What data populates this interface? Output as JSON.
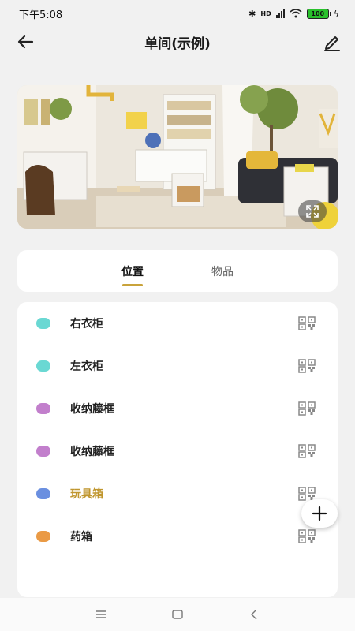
{
  "status_bar": {
    "time": "下午5:08",
    "network": "HD",
    "battery": "100"
  },
  "header": {
    "title": "单间(示例)"
  },
  "tabs": [
    {
      "label": "位置",
      "active": true
    },
    {
      "label": "物品",
      "active": false
    }
  ],
  "locations": [
    {
      "label": "右衣柜",
      "color": "#6ad8d3"
    },
    {
      "label": "左衣柜",
      "color": "#6ad8d3"
    },
    {
      "label": "收纳藤框",
      "color": "#c27fcc"
    },
    {
      "label": "收纳藤框",
      "color": "#c27fcc"
    },
    {
      "label": "玩具箱",
      "color": "#6a8fe0"
    },
    {
      "label": "药箱",
      "color": "#ea9a45"
    }
  ],
  "colors": {
    "accent": "#c9a33b",
    "highlight_text": "#c0962e"
  },
  "icons": [
    "back-arrow-icon",
    "edit-pencil-icon",
    "expand-icon",
    "qr-code-icon",
    "plus-icon",
    "menu-icon",
    "home-square-icon",
    "back-chevron-icon"
  ]
}
